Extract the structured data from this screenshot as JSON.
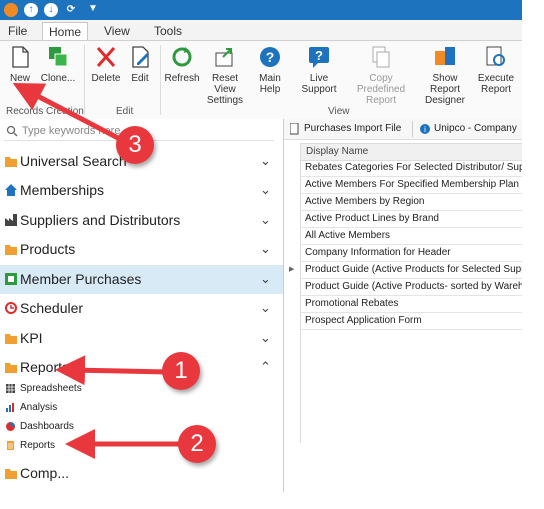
{
  "ribbon": {
    "tabs": [
      "File",
      "Home",
      "View",
      "Tools"
    ],
    "buttons": {
      "new": "New",
      "clone": "Clone...",
      "delete": "Delete",
      "edit": "Edit",
      "refresh": "Refresh",
      "reset_view": "Reset View Settings",
      "main_help": "Main Help",
      "live_support": "Live Support",
      "copy_predefined": "Copy Predefined Report",
      "show_designer": "Show Report Designer",
      "execute": "Execute Report"
    },
    "groups": {
      "records": "Records Creation",
      "edit": "Edit",
      "view": "View"
    }
  },
  "left_pane": {
    "search_placeholder": "Type keywords here",
    "nav": [
      {
        "label": "Universal Search",
        "icon": "folder-icon"
      },
      {
        "label": "Memberships",
        "icon": "house-icon"
      },
      {
        "label": "Suppliers and Distributors",
        "icon": "factory-icon"
      },
      {
        "label": "Products",
        "icon": "folder-icon"
      },
      {
        "label": "Member Purchases",
        "icon": "purchases-icon"
      },
      {
        "label": "Scheduler",
        "icon": "clock-icon"
      },
      {
        "label": "KPI",
        "icon": "folder-icon"
      },
      {
        "label": "Reports",
        "icon": "folder-icon"
      }
    ],
    "reports_sub": [
      "Spreadsheets",
      "Analysis",
      "Dashboards",
      "Reports"
    ],
    "last_item": "Comp..."
  },
  "right_pane": {
    "toolbar": {
      "import_file": "Purchases Import File",
      "company": "Unipco - Company"
    },
    "column_header": "Display Name",
    "rows": [
      "Rebates Categories For Selected Distributor/ Supplier",
      "Active Members For Specified Membership Plan",
      "Active Members by Region",
      "Active Product Lines by Brand",
      "All Active Members",
      "Company Information for Header",
      "Product Guide (Active Products for Selected Supplier)",
      "Product Guide (Active Products- sorted by Warehouse)",
      "Promotional Rebates",
      "Prospect Application Form"
    ]
  },
  "annotations": [
    "1",
    "2",
    "3"
  ],
  "colors": {
    "titlebar": "#1e73be",
    "selected": "#d9eaf7",
    "callout": "#e8383d",
    "folder": "#f0a030"
  }
}
